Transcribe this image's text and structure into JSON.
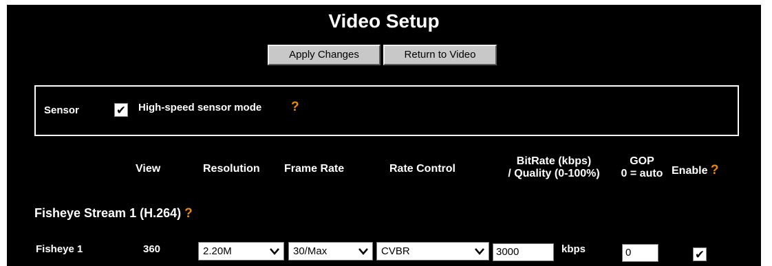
{
  "page": {
    "title": "Video Setup",
    "apply_label": "Apply Changes",
    "return_label": "Return to Video"
  },
  "sensor": {
    "label": "Sensor",
    "high_speed_label": "High-speed sensor mode",
    "high_speed_checked": true,
    "help": "?"
  },
  "table": {
    "headers": {
      "view": "View",
      "resolution": "Resolution",
      "frame_rate": "Frame Rate",
      "rate_control": "Rate Control",
      "bitrate_line1": "BitRate (kbps)",
      "bitrate_line2": "/ Quality (0-100%)",
      "gop_line1": "GOP",
      "gop_line2": "0 = auto",
      "enable": "Enable",
      "enable_help": "?"
    }
  },
  "stream": {
    "title": "Fisheye Stream 1 (H.264)",
    "help": "?",
    "row": {
      "name": "Fisheye 1",
      "view": "360",
      "resolution": "2.20M",
      "frame_rate": "30/Max",
      "rate_control": "CVBR",
      "bitrate": "3000",
      "bitrate_unit": "kbps",
      "gop": "0",
      "enabled": true
    }
  },
  "icons": {
    "checkmark": "checkmark-icon",
    "dropdown": "chevron-down-icon"
  },
  "colors": {
    "background": "#000000",
    "help": "#e8890c",
    "button": "#c8c8c8"
  }
}
